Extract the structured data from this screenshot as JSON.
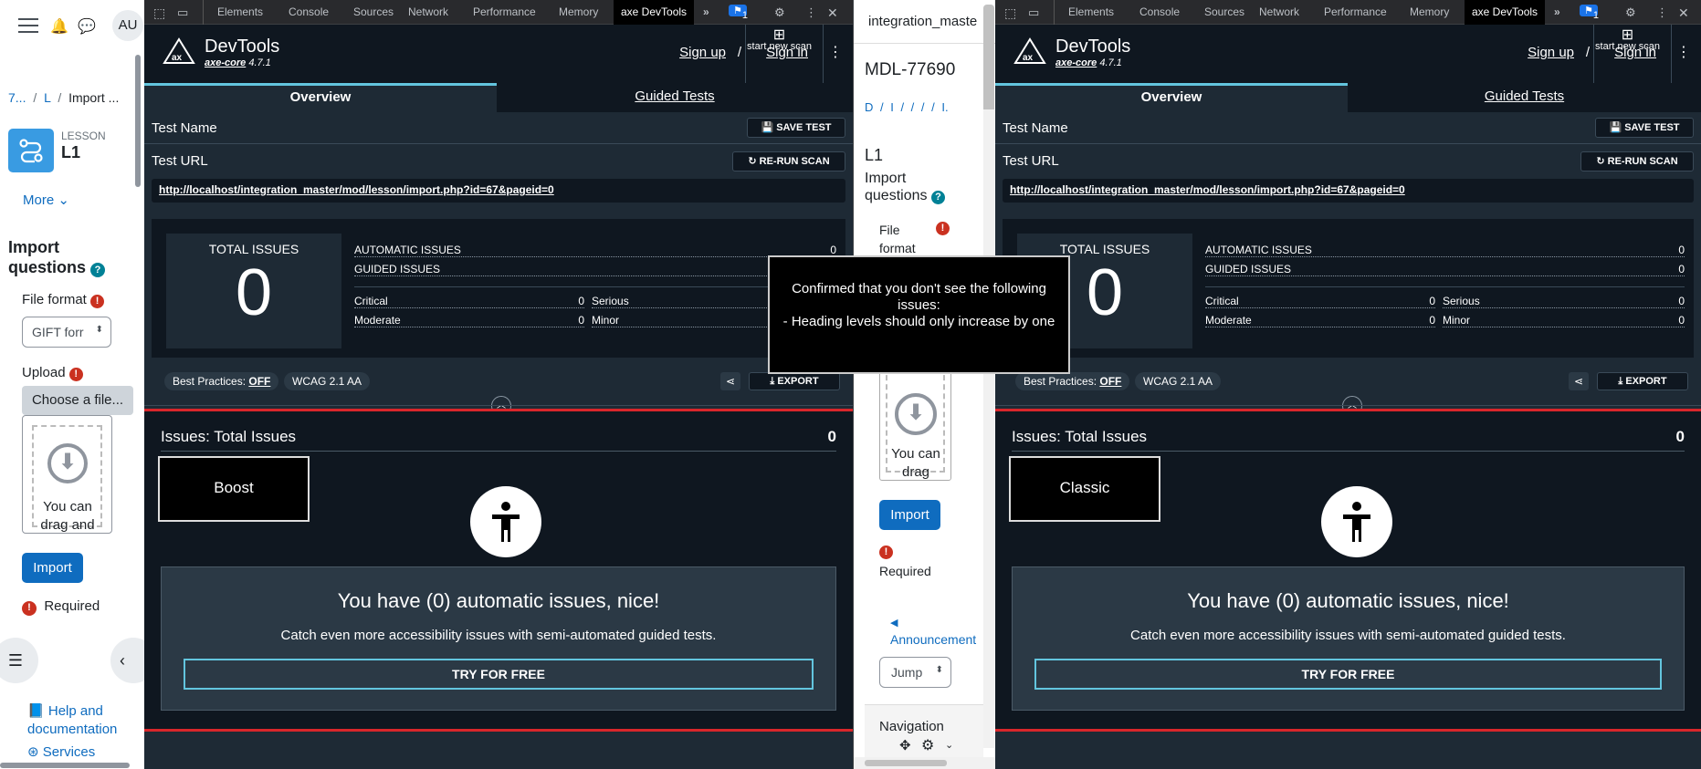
{
  "left": {
    "avatar": "AU",
    "breadcrumb": [
      "7...",
      "L",
      "Import ..."
    ],
    "lesson_kind": "LESSON",
    "lesson_name": "L1",
    "more": "More",
    "page_title": "Import questions",
    "file_format_label": "File format",
    "file_format_value": "GIFT forr",
    "upload_label": "Upload",
    "choose_file": "Choose a file...",
    "drop_text": "You can drag and",
    "import_btn": "Import",
    "required": "Required",
    "help_link": "Help and documentation",
    "services_link": "Services"
  },
  "devtools_tabs": [
    "Elements",
    "Console",
    "Sources",
    "Network",
    "Performance",
    "Memory",
    "axe DevTools"
  ],
  "devtools_badge": "1",
  "axe": {
    "title": "DevTools",
    "engine": "axe-core",
    "version": "4.7.1",
    "signup": "Sign up",
    "sep": "/",
    "signin": "Sign in",
    "start_scan": "start new scan",
    "tab_overview": "Overview",
    "tab_guided": "Guided Tests",
    "test_name": "Test Name",
    "save_test": "SAVE TEST",
    "test_url_label": "Test URL",
    "rerun": "RE-RUN SCAN",
    "url": "http://localhost/integration_master/mod/lesson/import.php?id=67&pageid=0",
    "total_issues_label": "TOTAL ISSUES",
    "total_issues": "0",
    "automatic_label": "AUTOMATIC ISSUES",
    "automatic": "0",
    "guided_label": "GUIDED ISSUES",
    "guided": "0",
    "critical_label": "Critical",
    "critical": "0",
    "serious_label": "Serious",
    "serious": "0",
    "moderate_label": "Moderate",
    "moderate": "0",
    "minor_label": "Minor",
    "minor": "0",
    "best_practices": "Best Practices:",
    "bp_state": "OFF",
    "wcag": "WCAG 2.1 AA",
    "export": "EXPORT",
    "issues_title": "Issues: Total Issues",
    "issues_count": "0",
    "nice": "You have (0) automatic issues, nice!",
    "catch_more": "Catch even more accessibility issues with semi-automated guided tests.",
    "try_free": "TRY FOR FREE"
  },
  "pane1_tag": "Boost",
  "pane2_tag": "Classic",
  "mid": {
    "tab_title": "integration_maste",
    "issue_id": "MDL-77690",
    "breadcrumb": "D / I / / / / I.",
    "lesson": "L1",
    "page_title": "Import questions",
    "file_format": "File format",
    "drop_text": "You can drag",
    "import_btn": "Import",
    "required": "Required",
    "announcement": "Announcement",
    "jump": "Jump",
    "navigation": "Navigation"
  },
  "tooltip": "Confirmed that you don't see the following issues:\n- Heading levels should only increase by one"
}
